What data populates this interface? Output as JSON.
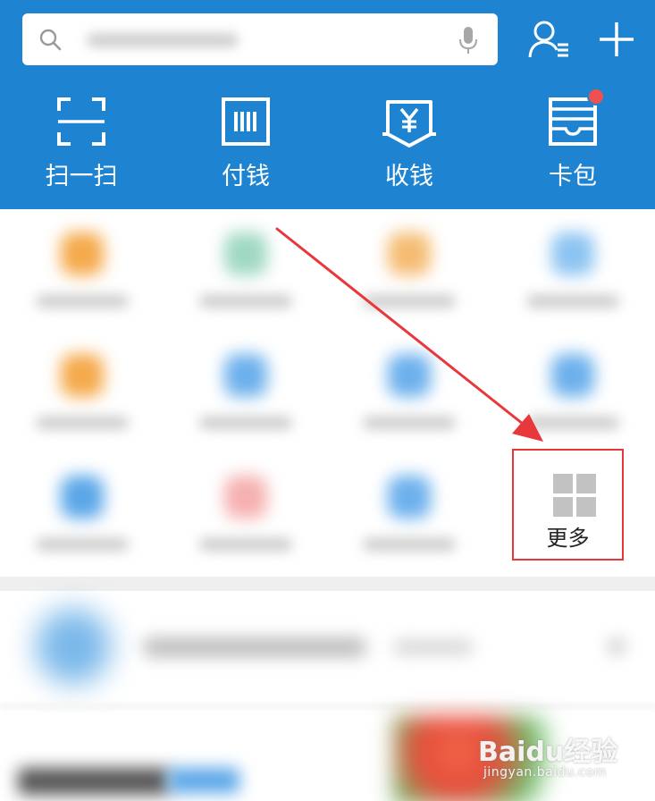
{
  "header": {
    "background": "#1e84d2",
    "search": {
      "icon": "search-icon",
      "mic": "mic-icon"
    },
    "contacts_icon": "contacts-icon",
    "add_icon": "plus-icon"
  },
  "quick_actions": [
    {
      "label": "扫一扫",
      "icon": "scan-icon"
    },
    {
      "label": "付钱",
      "icon": "barcode-pay-icon"
    },
    {
      "label": "收钱",
      "icon": "receive-money-icon"
    },
    {
      "label": "卡包",
      "icon": "card-wallet-icon",
      "badge": true
    }
  ],
  "grid": {
    "more": {
      "label": "更多",
      "icon": "grid-icon"
    },
    "highlight_color": "#e3393c"
  },
  "annotation": {
    "arrow_color": "#e8383b"
  },
  "watermark": {
    "brand": "Baidu经验",
    "url": "jingyan.baidu.com"
  }
}
